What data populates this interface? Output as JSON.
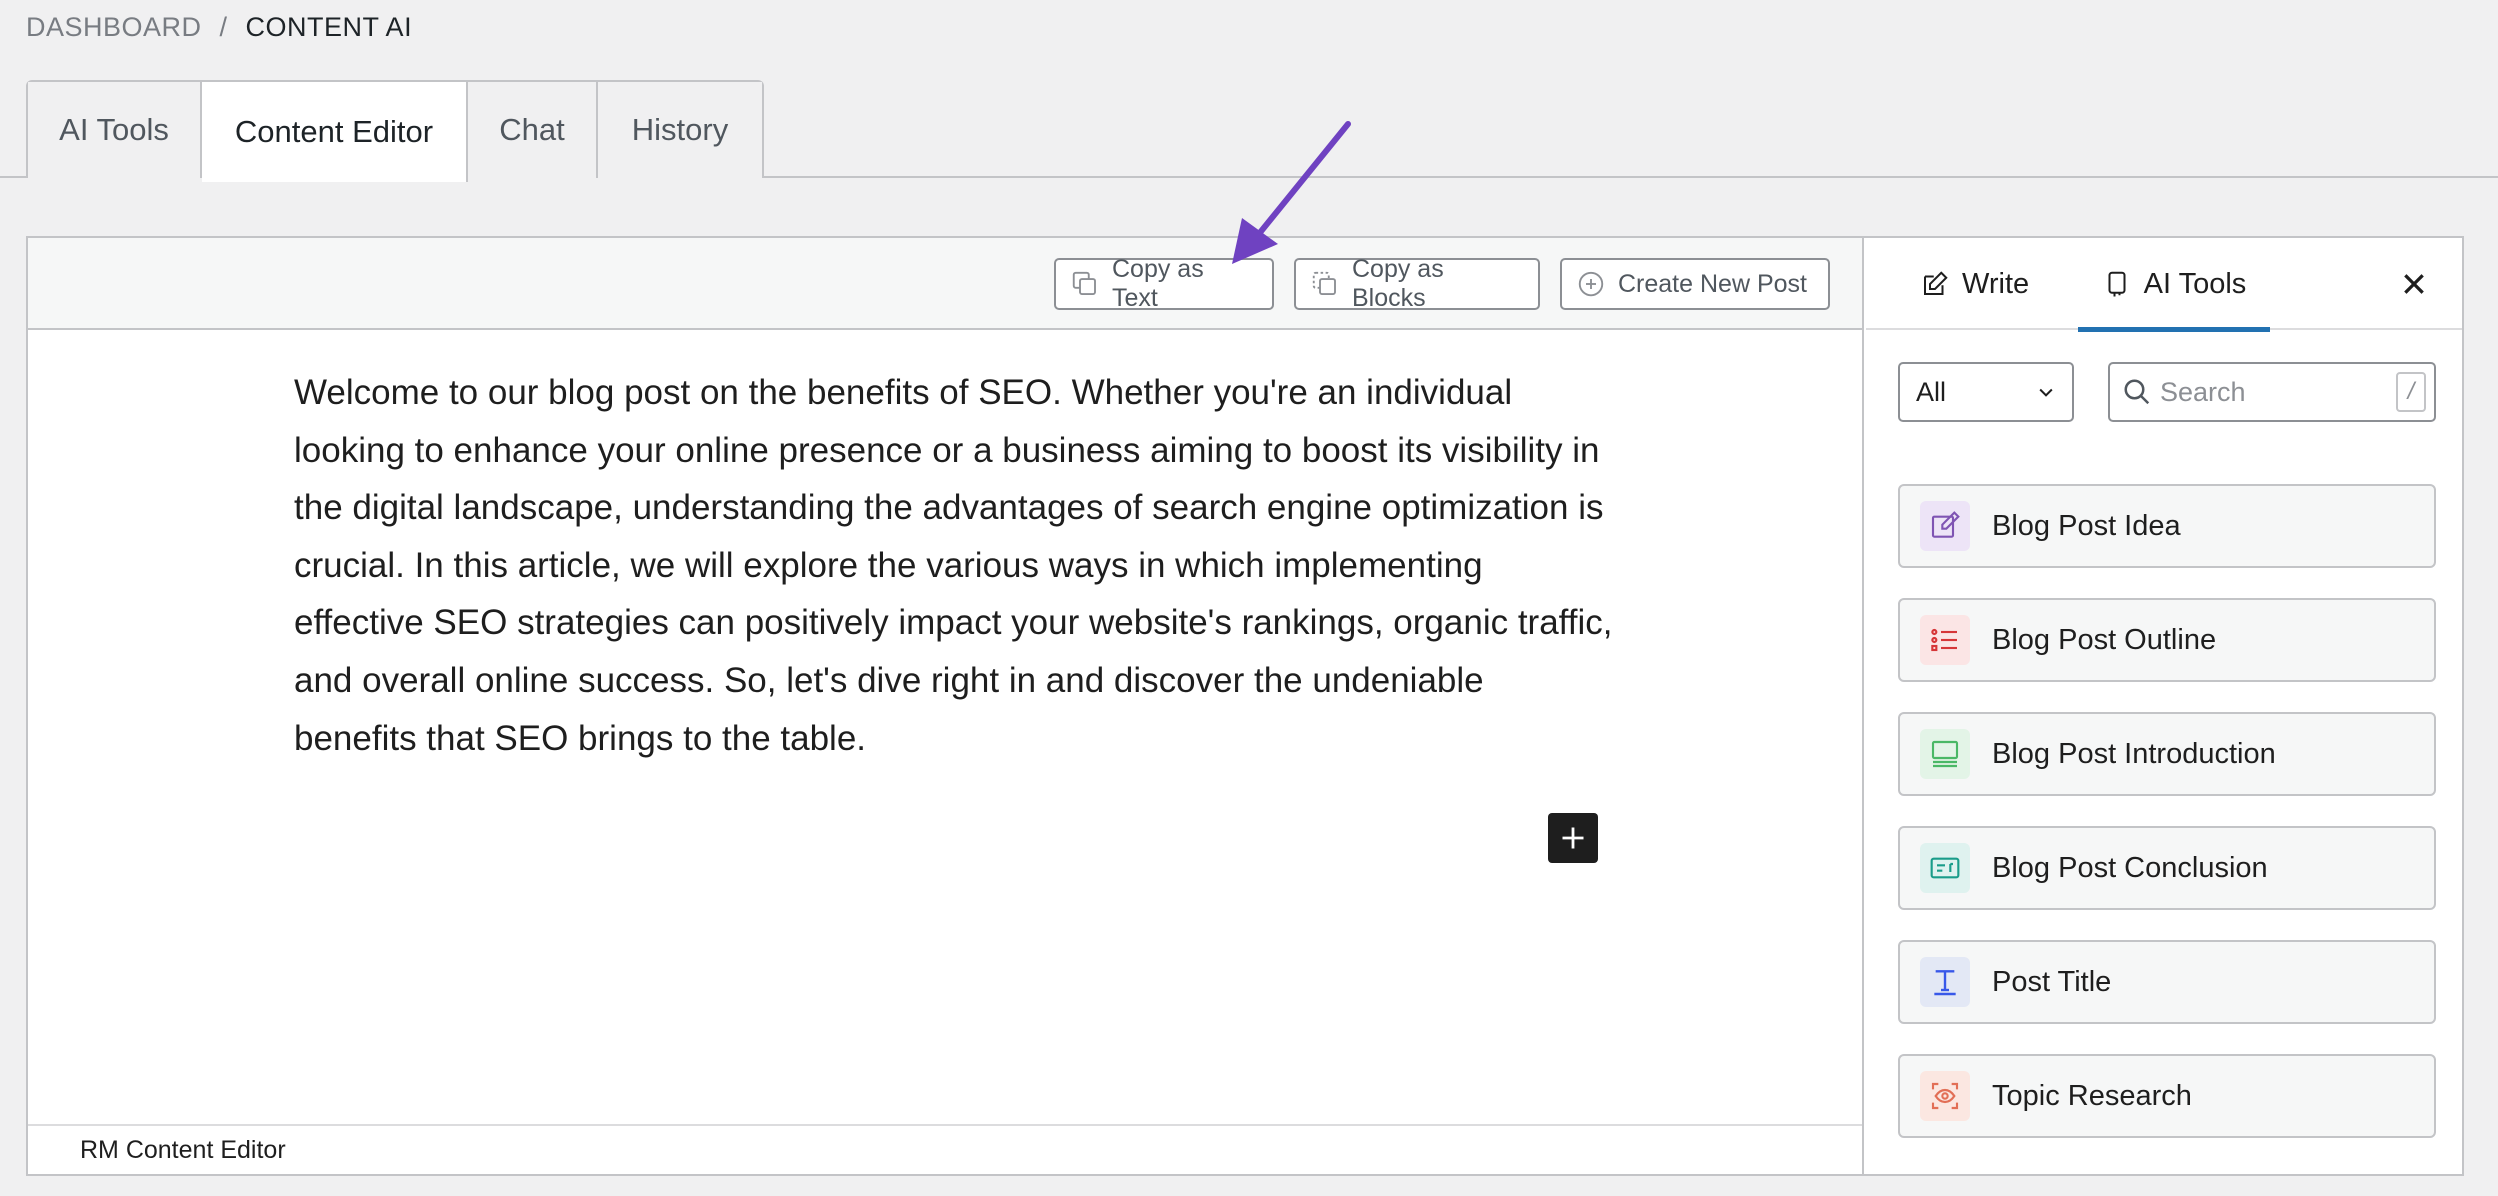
{
  "breadcrumb": {
    "parent": "DASHBOARD",
    "separator": "/",
    "current": "CONTENT AI"
  },
  "tabs": [
    {
      "label": "AI Tools",
      "active": false
    },
    {
      "label": "Content Editor",
      "active": true
    },
    {
      "label": "Chat",
      "active": false
    },
    {
      "label": "History",
      "active": false
    }
  ],
  "toolbar": {
    "copy_text": {
      "label": "Copy as Text",
      "icon": "copy-icon"
    },
    "copy_blocks": {
      "label": "Copy as Blocks",
      "icon": "copy-blocks-icon"
    },
    "create_post": {
      "label": "Create New Post",
      "icon": "plus-circle-icon"
    }
  },
  "editor": {
    "paragraph": "Welcome to our blog post on the benefits of SEO. Whether you're an individual looking to enhance your online presence or a business aiming to boost its visibility in the digital landscape, understanding the advantages of search engine optimization is crucial. In this article, we will explore the various ways in which implementing effective SEO strategies can positively impact your website's rankings, organic traffic, and overall online success. So, let's dive right in and discover the undeniable benefits that SEO brings to the table.",
    "footer": "RM Content Editor"
  },
  "sidebar": {
    "tabs": [
      {
        "label": "Write",
        "icon": "edit-icon",
        "active": false
      },
      {
        "label": "AI Tools",
        "icon": "ai-tools-icon",
        "active": true
      }
    ],
    "filter": {
      "selected": "All"
    },
    "search": {
      "placeholder": "Search",
      "shortcut": "/"
    },
    "tools": [
      {
        "label": "Blog Post Idea",
        "icon": "pencil-square-icon",
        "color": "#7f54b3",
        "bg": "#ede4f7"
      },
      {
        "label": "Blog Post Outline",
        "icon": "list-icon",
        "color": "#d63638",
        "bg": "#fbe5e5"
      },
      {
        "label": "Blog Post Introduction",
        "icon": "intro-icon",
        "color": "#4ab866",
        "bg": "#e3f4e7"
      },
      {
        "label": "Blog Post Conclusion",
        "icon": "conclusion-icon",
        "color": "#1a9c8a",
        "bg": "#dff2ef"
      },
      {
        "label": "Post Title",
        "icon": "title-icon",
        "color": "#3858e9",
        "bg": "#e3e8f5"
      },
      {
        "label": "Topic Research",
        "icon": "eye-scan-icon",
        "color": "#e26f56",
        "bg": "#fbe7e1"
      }
    ]
  },
  "colors": {
    "accent": "#2271b1",
    "annotation": "#6f42c1"
  }
}
